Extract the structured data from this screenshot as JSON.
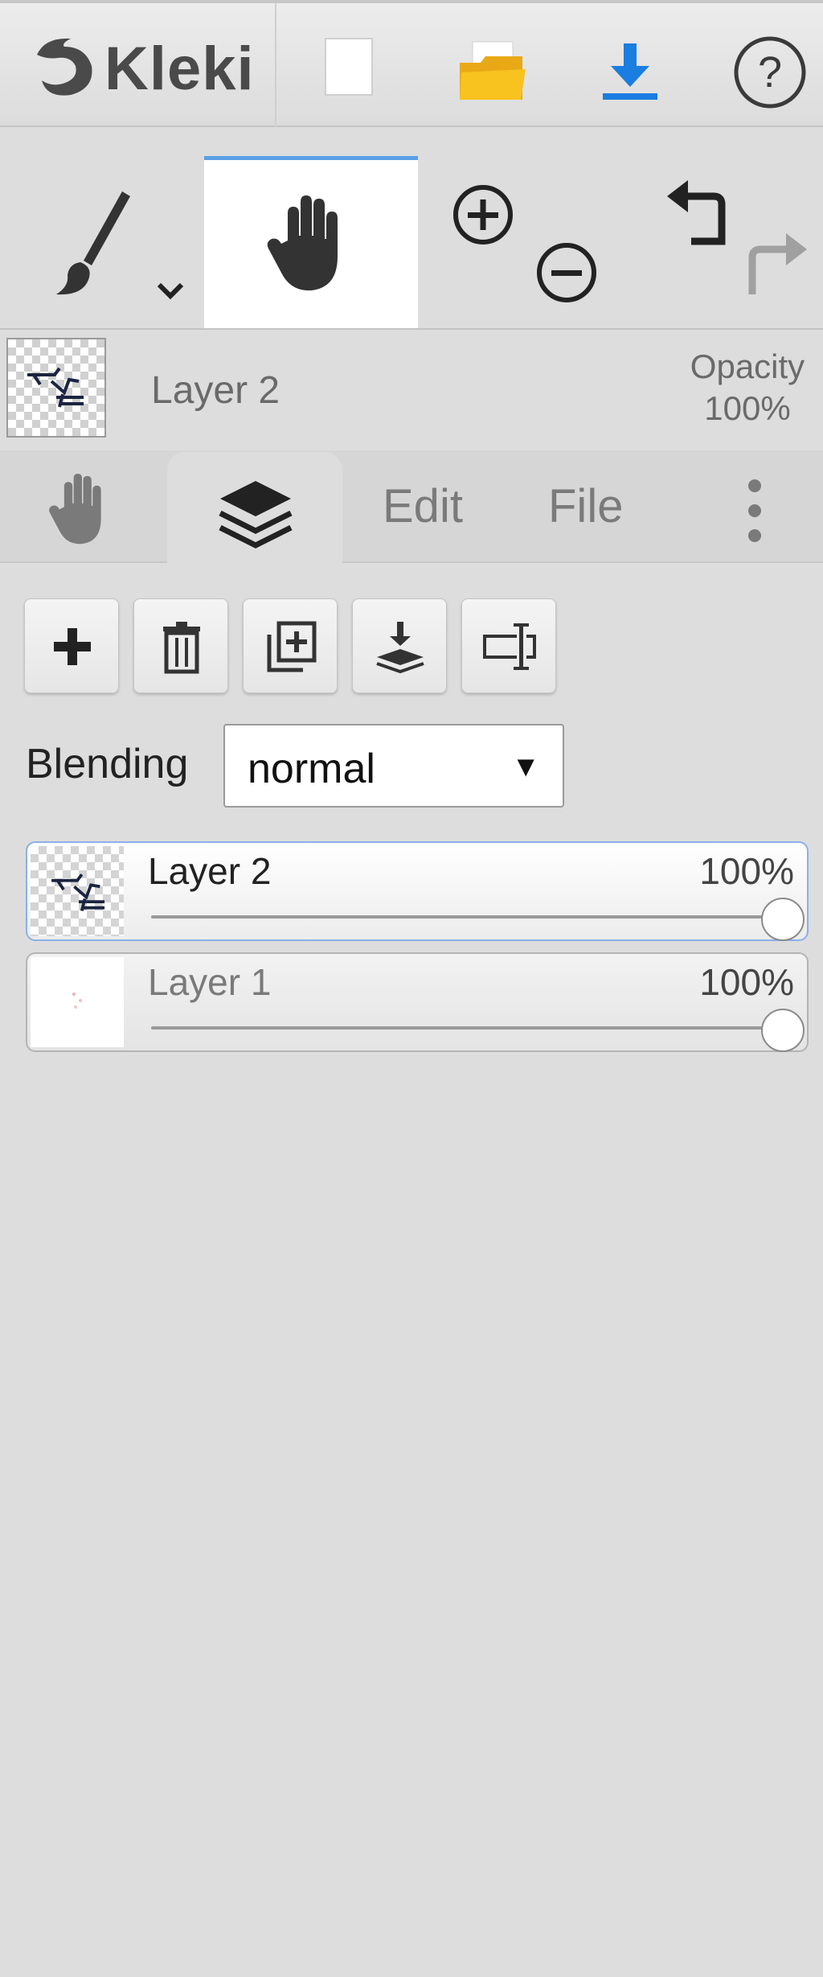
{
  "app": {
    "logo_text": "Kleki"
  },
  "topbar": {
    "icons": [
      "new-document-icon",
      "open-folder-icon",
      "download-icon",
      "help-icon"
    ],
    "help_glyph": "?",
    "accent_download": "#1a7ee0",
    "folder_color": "#f4c01e"
  },
  "tools": {
    "brush": "brush-icon",
    "hand": "hand-icon",
    "zoom_in": "zoom-in-icon",
    "zoom_out": "zoom-out-icon",
    "undo": "undo-icon",
    "redo": "redo-icon",
    "active_accent": "#5aa0e6"
  },
  "current_layer": {
    "name": "Layer 2",
    "opacity_label": "Opacity",
    "opacity_value": "100%"
  },
  "tabs": {
    "hand_icon": "hand-icon",
    "layers_icon": "layers-icon",
    "edit": "Edit",
    "file": "File",
    "more_icon": "more-vertical-icon"
  },
  "layer_panel": {
    "buttons": [
      "add-layer-icon",
      "delete-layer-icon",
      "duplicate-layer-icon",
      "merge-down-icon",
      "rename-layer-icon"
    ],
    "blending_label": "Blending",
    "blending_value": "normal",
    "blending_arrow": "▼",
    "layers": [
      {
        "name": "Layer 2",
        "opacity": "100%",
        "opacity_fraction": 1.0,
        "selected": true
      },
      {
        "name": "Layer 1",
        "opacity": "100%",
        "opacity_fraction": 1.0,
        "selected": false
      }
    ]
  }
}
